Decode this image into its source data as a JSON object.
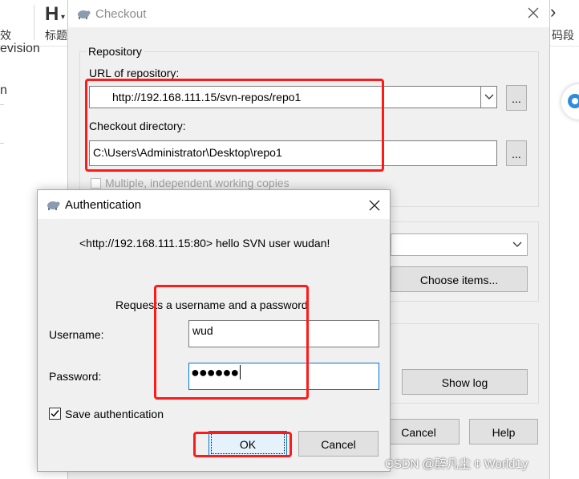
{
  "background_app": {
    "ribbon_left_text": "效",
    "ribbon_heading_glyph": "H",
    "ribbon_heading_label": "标题",
    "ribbon_right_glyph": "",
    "ribbon_right_label": "码段",
    "left_text": "evision",
    "left_text2": "n"
  },
  "checkout": {
    "title": "Checkout",
    "repository_group_label": "Repository",
    "url_label": "URL of repository:",
    "url_value": "http://192.168.111.15/svn-repos/repo1",
    "dir_label": "Checkout directory:",
    "dir_value": "C:\\Users\\Administrator\\Desktop\\repo1",
    "browse_button": "...",
    "multiple_copies_label": "Multiple, independent working copies",
    "choose_items_button": "Choose items...",
    "show_log_button": "Show log",
    "cancel_button": "Cancel",
    "help_button": "Help"
  },
  "auth": {
    "title": "Authentication",
    "message": "<http://192.168.111.15:80>  hello SVN user wudan!",
    "request_text": "Requests a username and a password",
    "username_label": "Username:",
    "username_value": "wud",
    "password_label": "Password:",
    "password_value": "●●●●●●",
    "save_auth_label": "Save authentication",
    "save_auth_checked": true,
    "ok_button": "OK",
    "cancel_button": "Cancel"
  },
  "watermark": "CSDN @醉凡尘 ¢ World1y",
  "colors": {
    "highlight_red": "#ff1a1a",
    "focus_blue": "#0078d7",
    "dialog_bg": "#f0f0f0"
  }
}
